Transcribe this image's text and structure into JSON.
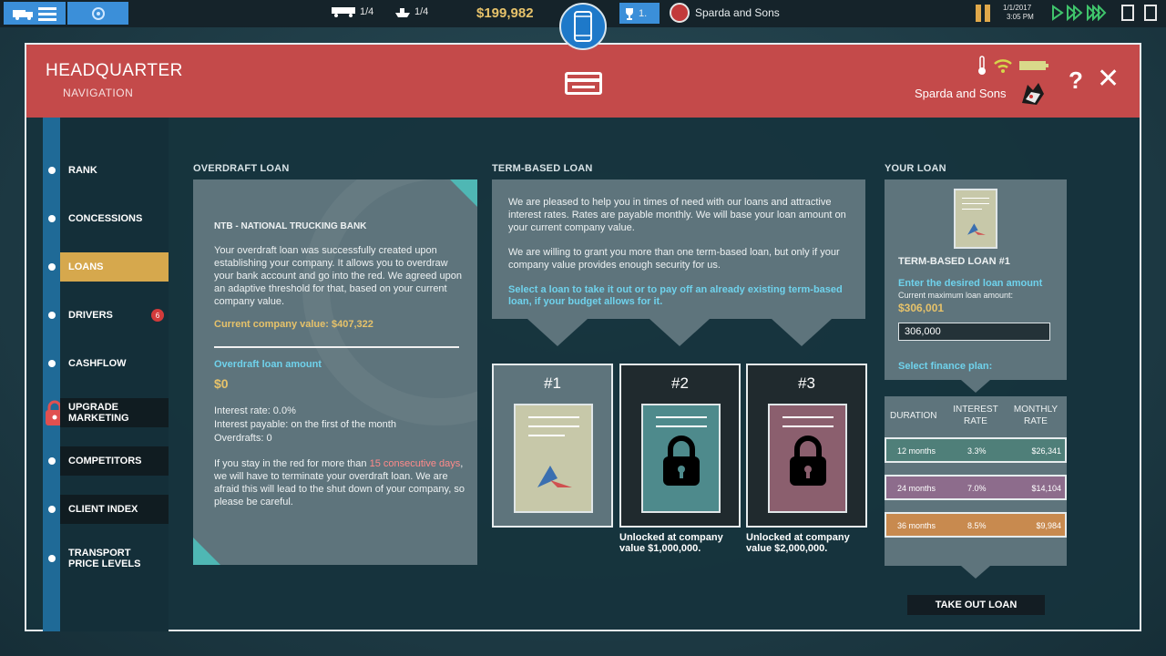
{
  "topbar": {
    "trucks": "1/4",
    "ships": "1/4",
    "money": "$199,982",
    "rank": "1.",
    "company": "Sparda and Sons",
    "date": "1/1/2017",
    "time": "3:05 PM"
  },
  "header": {
    "title": "HEADQUARTER",
    "subtitle": "NAVIGATION",
    "company": "Sparda and Sons",
    "help": "?",
    "close": "✕"
  },
  "sidebar": {
    "items": [
      {
        "label": "RANK"
      },
      {
        "label": "CONCESSIONS"
      },
      {
        "label": "LOANS"
      },
      {
        "label": "DRIVERS",
        "badge": "6"
      },
      {
        "label": "CASHFLOW"
      },
      {
        "label": "UPGRADE MARKETING"
      },
      {
        "label": "COMPETITORS"
      },
      {
        "label": "CLIENT INDEX"
      },
      {
        "label": "TRANSPORT PRICE LEVELS"
      }
    ]
  },
  "overdraft": {
    "section_title": "OVERDRAFT LOAN",
    "bank": "NTB - NATIONAL TRUCKING BANK",
    "text": "Your overdraft loan was successfully created upon establishing your company. It allows you to overdraw your bank account and go into the red. We agreed upon an adaptive threshold for that, based on your current company value.",
    "company_value": "Current company value: $407,322",
    "amount_label": "Overdraft loan amount",
    "amount": "$0",
    "interest_rate": "Interest rate: 0.0%",
    "interest_payable": "Interest payable: on the first of the month",
    "overdrafts": "Overdrafts: 0",
    "warn_pre": "If you stay in the red for more than ",
    "warn_red": "15 consecutive days",
    "warn_post": ", we will have to terminate your overdraft loan. We are afraid this will lead to the shut down of your company, so please be careful."
  },
  "term": {
    "section_title": "TERM-BASED LOAN",
    "p1": "We are pleased to help you in times of need with our loans and attractive interest rates. Rates are payable monthly. We will base your loan amount on your current company value.",
    "p2": "We are willing to grant you more than one term-based loan, but only if your company value provides enough security for us.",
    "p3": "Select a loan to take it out or to pay off an already existing term-based loan, if your budget allows for it.",
    "slots": [
      {
        "num": "#1",
        "note": ""
      },
      {
        "num": "#2",
        "note": "Unlocked at company value $1,000,000."
      },
      {
        "num": "#3",
        "note": "Unlocked at company value $2,000,000."
      }
    ]
  },
  "your_loan": {
    "section_title": "YOUR LOAN",
    "title": "TERM-BASED LOAN #1",
    "enter_label": "Enter the desired loan amount",
    "max_label": "Current maximum loan amount:",
    "max_value": "$306,001",
    "input_value": "306,000",
    "plan_label": "Select finance plan:",
    "headers": {
      "duration": "DURATION",
      "interest": "INTEREST RATE",
      "monthly": "MONTHLY RATE"
    },
    "plans": [
      {
        "duration": "12 months",
        "interest": "3.3%",
        "monthly": "$26,341"
      },
      {
        "duration": "24 months",
        "interest": "7.0%",
        "monthly": "$14,104"
      },
      {
        "duration": "36 months",
        "interest": "8.5%",
        "monthly": "$9,984"
      }
    ],
    "take_out": "TAKE OUT LOAN"
  },
  "colors": {
    "header_red": "#c44a4a",
    "active_gold": "#d6a84d",
    "money_gold": "#e6c26a",
    "link_blue": "#6fd2ec",
    "warn_red": "#ff8a8a"
  }
}
